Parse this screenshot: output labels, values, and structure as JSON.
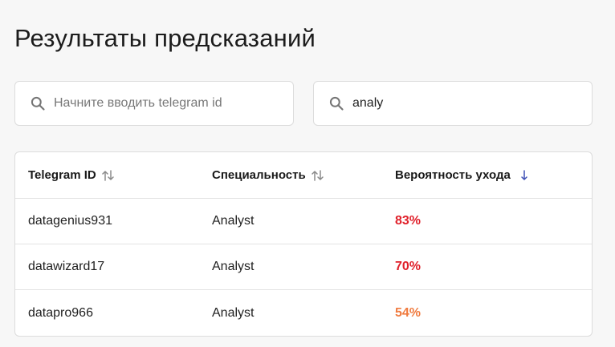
{
  "page": {
    "title": "Результаты предсказаний"
  },
  "filters": {
    "telegram_search": {
      "placeholder": "Начните вводить telegram id",
      "value": ""
    },
    "specialty_search": {
      "placeholder": "",
      "value": "analy"
    }
  },
  "table": {
    "columns": [
      {
        "label": "Telegram ID",
        "sort": "none"
      },
      {
        "label": "Специальность",
        "sort": "none"
      },
      {
        "label": "Вероятность ухода",
        "sort": "desc"
      }
    ],
    "rows": [
      {
        "telegram_id": "datagenius931",
        "specialty": "Analyst",
        "probability": "83%",
        "color": "#e0202a"
      },
      {
        "telegram_id": "datawizard17",
        "specialty": "Analyst",
        "probability": "70%",
        "color": "#e0202a"
      },
      {
        "telegram_id": "datapro966",
        "specialty": "Analyst",
        "probability": "54%",
        "color": "#f07b3f"
      }
    ]
  },
  "colors": {
    "accent": "#3f51b5",
    "high_risk": "#e0202a",
    "medium_risk": "#f07b3f"
  },
  "icons": {
    "search": "search-icon",
    "sort": "sort-arrows-icon",
    "sort_desc": "arrow-down-icon"
  }
}
